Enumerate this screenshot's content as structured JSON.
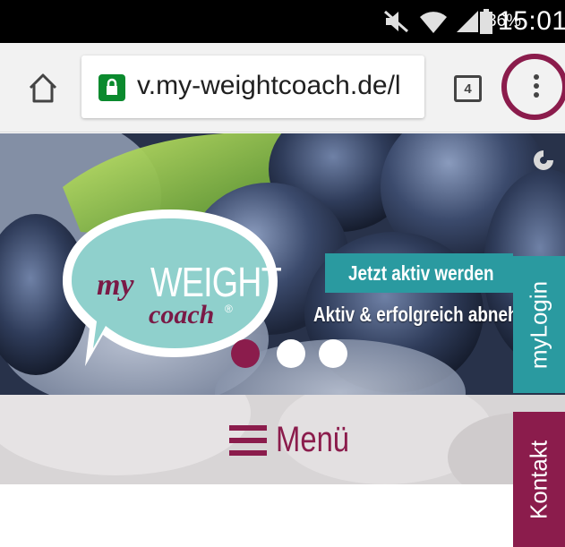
{
  "status_bar": {
    "battery_percent": "36%",
    "time": "15:01",
    "icons": [
      "mute-icon",
      "wifi-icon",
      "signal-icon",
      "battery-icon"
    ]
  },
  "browser": {
    "url": "v.my-weightcoach.de/l",
    "tab_count": "4",
    "icons": [
      "home-icon",
      "lock-icon",
      "overflow-menu-icon"
    ],
    "highlight_color": "#8b1c4c"
  },
  "hero": {
    "logo": {
      "my": "my",
      "weight": "WEIGHT",
      "coach": "coach",
      "registered": "®"
    },
    "cta_label": "Jetzt aktiv werden",
    "subline": "Aktiv & erfolgreich abnehmen",
    "slider_dots": 3,
    "active_dot": 1
  },
  "menu": {
    "label": "Menü",
    "icon": "hamburger-icon"
  },
  "side_tabs": {
    "login": "myLogin",
    "kontakt": "Kontakt"
  },
  "colors": {
    "teal": "#2a9aa0",
    "berry": "#8b1c4c",
    "bubble": "#8fd0cc"
  }
}
